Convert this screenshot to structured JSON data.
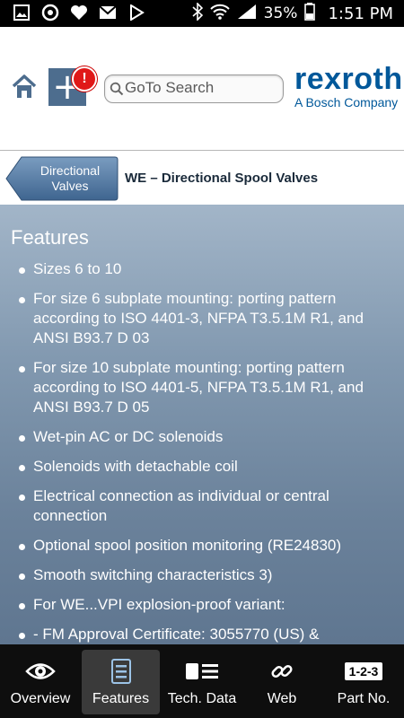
{
  "status_bar": {
    "icons_left": [
      "gallery-icon",
      "sync-icon",
      "iheart-icon",
      "mail-icon",
      "play-store-icon"
    ],
    "battery": "35%",
    "time": "1:51 PM"
  },
  "header": {
    "badge": "!",
    "search_placeholder": "GoTo Search",
    "brand_name": "rexroth",
    "brand_sub": "A Bosch Company",
    "brand_color": "#00589a",
    "badge_color": "#e01818"
  },
  "breadcrumb": {
    "back_label": "Directional Valves",
    "title": "WE – Directional Spool Valves"
  },
  "content": {
    "section_title": "Features",
    "features": [
      "Sizes 6 to 10",
      "For size 6 subplate mounting: porting pattern according to ISO 4401-3, NFPA T3.5.1M R1, and ANSI B93.7 D 03",
      "For size 10 subplate mounting: porting pattern according to ISO 4401-5, NFPA T3.5.1M R1, and ANSI B93.7 D 05",
      "Wet-pin AC or DC solenoids",
      "Solenoids with detachable coil",
      "Electrical connection as individual or central connection",
      "Optional spool position monitoring (RE24830)",
      "Smooth switching characteristics 3)",
      "For WE...VPI explosion-proof variant:",
      "- FM Approval Certificate: 3055770 (US) &"
    ]
  },
  "bottom_nav": {
    "tabs": [
      {
        "label": "Overview",
        "icon": "eye-icon"
      },
      {
        "label": "Features",
        "icon": "list-icon",
        "active": true
      },
      {
        "label": "Tech. Data",
        "icon": "data-sheet-icon"
      },
      {
        "label": "Web",
        "icon": "link-icon"
      },
      {
        "label": "Part No.",
        "icon": "part-number-icon",
        "icon_text": "1-2-3"
      }
    ]
  }
}
